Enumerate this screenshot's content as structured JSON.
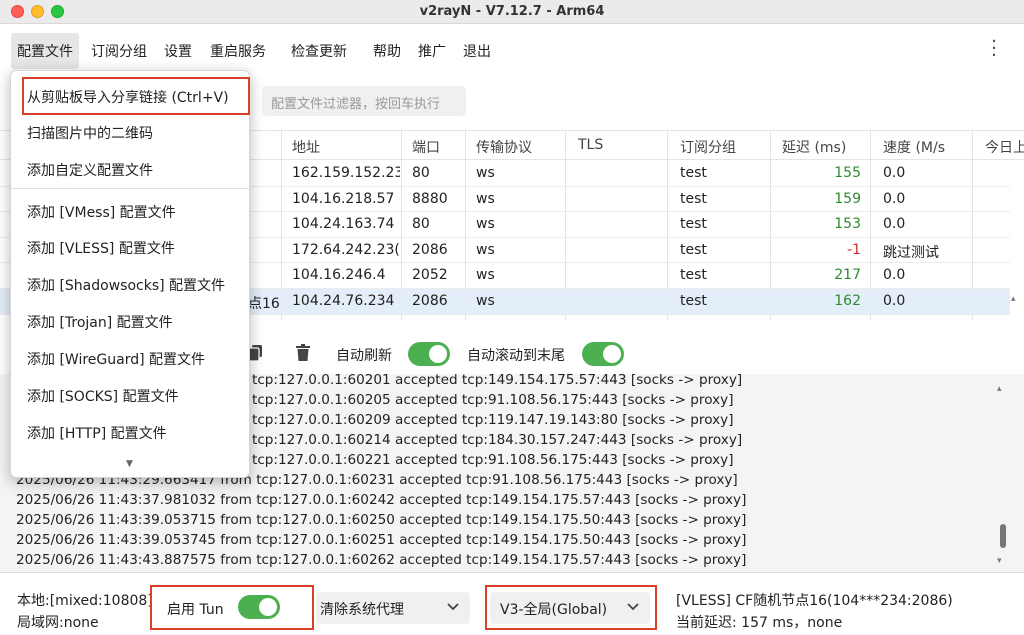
{
  "window": {
    "title": "v2rayN - V7.12.7 - Arm64"
  },
  "menu": {
    "items": [
      "配置文件",
      "订阅分组",
      "设置",
      "重启服务",
      "检查更新",
      "帮助",
      "推广",
      "退出"
    ]
  },
  "filter": {
    "placeholder": "配置文件过滤器，按回车执行"
  },
  "grid": {
    "columns": [
      "地址",
      "端口",
      "传输协议",
      "TLS",
      "订阅分组",
      "延迟 (ms)",
      "速度 (M/s",
      "今日上"
    ],
    "rows": [
      {
        "name": "",
        "address": "162.159.152.23",
        "port": "80",
        "transport": "ws",
        "tls": "",
        "group": "test",
        "delay": "155",
        "speed": "0.0"
      },
      {
        "name": "",
        "address": "104.16.218.57",
        "port": "8880",
        "transport": "ws",
        "tls": "",
        "group": "test",
        "delay": "159",
        "speed": "0.0"
      },
      {
        "name": "",
        "address": "104.24.163.74",
        "port": "80",
        "transport": "ws",
        "tls": "",
        "group": "test",
        "delay": "153",
        "speed": "0.0"
      },
      {
        "name": "",
        "address": "172.64.242.23(",
        "port": "2086",
        "transport": "ws",
        "tls": "",
        "group": "test",
        "delay": "-1",
        "speed": "跳过测试"
      },
      {
        "name": "",
        "address": "104.16.246.4",
        "port": "2052",
        "transport": "ws",
        "tls": "",
        "group": "test",
        "delay": "217",
        "speed": "0.0"
      },
      {
        "name": "点16",
        "address": "104.24.76.234",
        "port": "2086",
        "transport": "ws",
        "tls": "",
        "group": "test",
        "delay": "162",
        "speed": "0.0"
      }
    ]
  },
  "log_toolbar": {
    "auto_refresh_label": "自动刷新",
    "auto_scroll_label": "自动滚动到末尾",
    "auto_refresh": true,
    "auto_scroll": true
  },
  "log_lines": [
    "tcp:127.0.0.1:60201 accepted tcp:149.154.175.57:443 [socks -> proxy]",
    "tcp:127.0.0.1:60205 accepted tcp:91.108.56.175:443 [socks -> proxy]",
    "tcp:127.0.0.1:60209 accepted tcp:119.147.19.143:80 [socks -> proxy]",
    "tcp:127.0.0.1:60214 accepted tcp:184.30.157.247:443 [socks -> proxy]",
    "tcp:127.0.0.1:60221 accepted tcp:91.108.56.175:443 [socks -> proxy]",
    "2025/06/26 11:43:29.663417 from tcp:127.0.0.1:60231 accepted tcp:91.108.56.175:443 [socks -> proxy]",
    "2025/06/26 11:43:37.981032 from tcp:127.0.0.1:60242 accepted tcp:149.154.175.57:443 [socks -> proxy]",
    "2025/06/26 11:43:39.053715 from tcp:127.0.0.1:60250 accepted tcp:149.154.175.50:443 [socks -> proxy]",
    "2025/06/26 11:43:39.053745 from tcp:127.0.0.1:60251 accepted tcp:149.154.175.50:443 [socks -> proxy]",
    "2025/06/26 11:43:43.887575 from tcp:127.0.0.1:60262 accepted tcp:149.154.175.57:443 [socks -> proxy]"
  ],
  "status": {
    "local": "本地:[mixed:10808]",
    "lan": "局域网:none",
    "tun_label": "启用 Tun",
    "tun_enabled": true,
    "sysproxy": "清除系统代理",
    "routing": "V3-全局(Global)",
    "node": "[VLESS] CF随机节点16(104***234:2086)",
    "current_delay": "当前延迟: 157 ms，none"
  },
  "dropdown": {
    "items": [
      "从剪贴板导入分享链接 (Ctrl+V)",
      "扫描图片中的二维码",
      "添加自定义配置文件",
      "添加 [VMess] 配置文件",
      "添加 [VLESS] 配置文件",
      "添加 [Shadowsocks] 配置文件",
      "添加 [Trojan] 配置文件",
      "添加 [WireGuard] 配置文件",
      "添加 [SOCKS] 配置文件",
      "添加 [HTTP] 配置文件"
    ]
  },
  "colors": {
    "delay_ok": "#2e8b2e",
    "delay_fail": "#d32f2f",
    "toggle_on": "#4caf50",
    "highlight_box": "#d9412b"
  },
  "icons": [
    "copy-icon",
    "trash-icon",
    "chevron-down-icon",
    "kebab-menu-icon",
    "chevron-down-more-icon"
  ]
}
